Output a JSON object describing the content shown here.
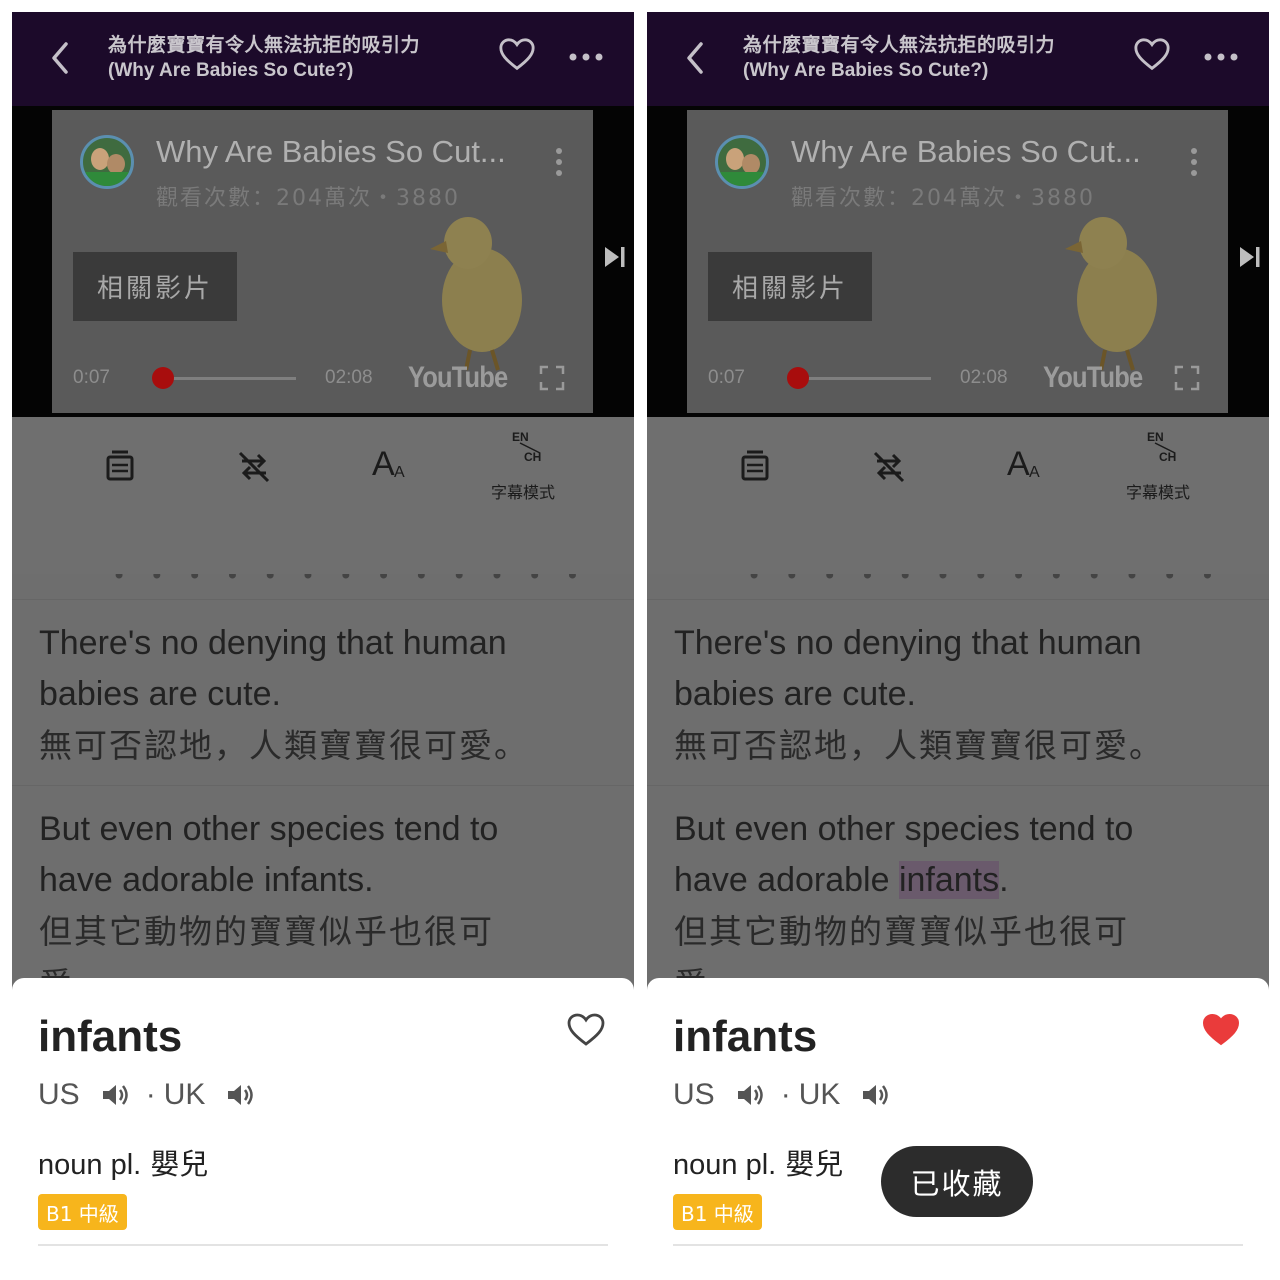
{
  "header": {
    "title_zh": "為什麼寶寶有令人無法抗拒的吸引力",
    "title_en": "(Why Are Babies So Cute?)"
  },
  "video": {
    "title": "Why Are Babies So Cut...",
    "subtitle": "觀看次數：204萬次・3880",
    "related_label": "相關影片",
    "current_time": "0:07",
    "total_time": "02:08",
    "progress_fraction": 0.055,
    "logo_text": "YouTube"
  },
  "toolbar": {
    "subtitle_mode_en": "EN",
    "subtitle_mode_ch": "CH",
    "subtitle_mode_label": "字幕模式"
  },
  "transcript": {
    "prev_fragment": "• • • • • • •   • • • • • •",
    "sentences": [
      {
        "en": "There's no denying that human babies are cute.",
        "zh": "無可否認地，人類寶寶很可愛。"
      },
      {
        "en_before": "But even other species tend to have adorable ",
        "en_word": "infants",
        "en_after": ".",
        "zh": "但其它動物的寶寶似乎也很可",
        "zh_cont": "愛"
      }
    ]
  },
  "card": {
    "word": "infants",
    "us_label": "US",
    "dot": "·",
    "uk_label": "UK",
    "pos": "noun pl.",
    "meaning": "嬰兒",
    "level": "B1 中級"
  },
  "toast": {
    "text": "已收藏"
  },
  "colors": {
    "header_bg": "#1c0a2a",
    "heart_filled": "#ea3b3b",
    "level_badge": "#f7b51c",
    "progress_knob": "#a80d0d"
  },
  "icons": {
    "back": "chevron-left-icon",
    "favorite": "heart-icon",
    "more": "more-horizontal-icon",
    "skip": "skip-next-icon",
    "fullscreen": "fullscreen-icon",
    "playlist": "playlist-icon",
    "no_repeat": "repeat-off-icon",
    "font_size": "font-size-icon",
    "speaker": "speaker-icon"
  }
}
